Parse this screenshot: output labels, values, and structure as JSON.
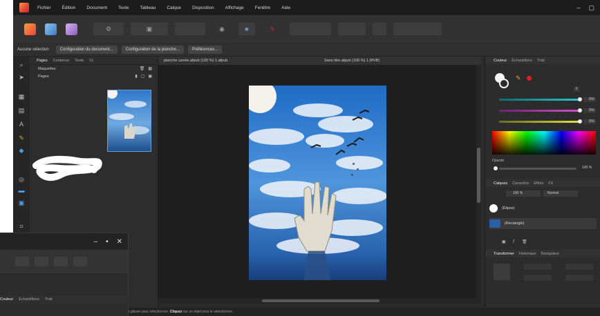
{
  "menubar": {
    "items": [
      "Fichier",
      "Édition",
      "Document",
      "Texte",
      "Tableau",
      "Calque",
      "Disposition",
      "Affichage",
      "Fenêtre",
      "Aide"
    ],
    "window_controls": [
      "–",
      "▢"
    ]
  },
  "toolbar": {
    "personas": [
      {
        "name": "publisher-persona",
        "color": "#f07a2e"
      },
      {
        "name": "photo-persona",
        "color": "#5e9bd6"
      },
      {
        "name": "designer-persona",
        "color": "#b58ad8"
      }
    ]
  },
  "context_bar": {
    "label": "Aucune sélection",
    "buttons": [
      "Configuration du document...",
      "Configuration de la planche...",
      "Préférences..."
    ]
  },
  "pages_panel": {
    "tabs": [
      "Pages",
      "Contenus",
      "Texte",
      "Cr."
    ],
    "rows": [
      "Maquettes",
      "Pages"
    ]
  },
  "document": {
    "tabs": [
      "planche carrée.afpub (100 %) 1.afpub",
      "Sans titre.afpub (100 %) 1 (RVB)"
    ]
  },
  "status": {
    "prefix": "Faites glisser pour sélectionner.",
    "bold": "Cliquez",
    "suffix": "sur un objet pour le sélectionner."
  },
  "right_panel": {
    "color_tabs": [
      "Couleur",
      "Échantillons",
      "Trait"
    ],
    "hsl_hex": "0",
    "rgb_values": [
      "255",
      "255",
      "255"
    ],
    "opacity_label": "Opacité",
    "opacity_value": "100 %",
    "layer_tabs": [
      "Calques",
      "Caractère",
      "Effets",
      "FX"
    ],
    "layer_blend": "100 %",
    "layer_mode": "Normal",
    "layers": [
      {
        "name": "(Élipse)",
        "color": "#ffffff"
      },
      {
        "name": "(Rectangle)",
        "color": "#2a5fa8"
      }
    ],
    "transform_tabs": [
      "Transformer",
      "Historique",
      "Navigateur"
    ],
    "colors": {
      "accent_red": "#e02020",
      "cyan": "#27c6ce",
      "magenta": "#d24fd0",
      "yellow": "#e6e14a"
    }
  },
  "float_window": {
    "controls": [
      "–",
      "▪",
      "✕"
    ],
    "tabs": [
      "Couleur",
      "Échantillons",
      "Trait"
    ]
  }
}
